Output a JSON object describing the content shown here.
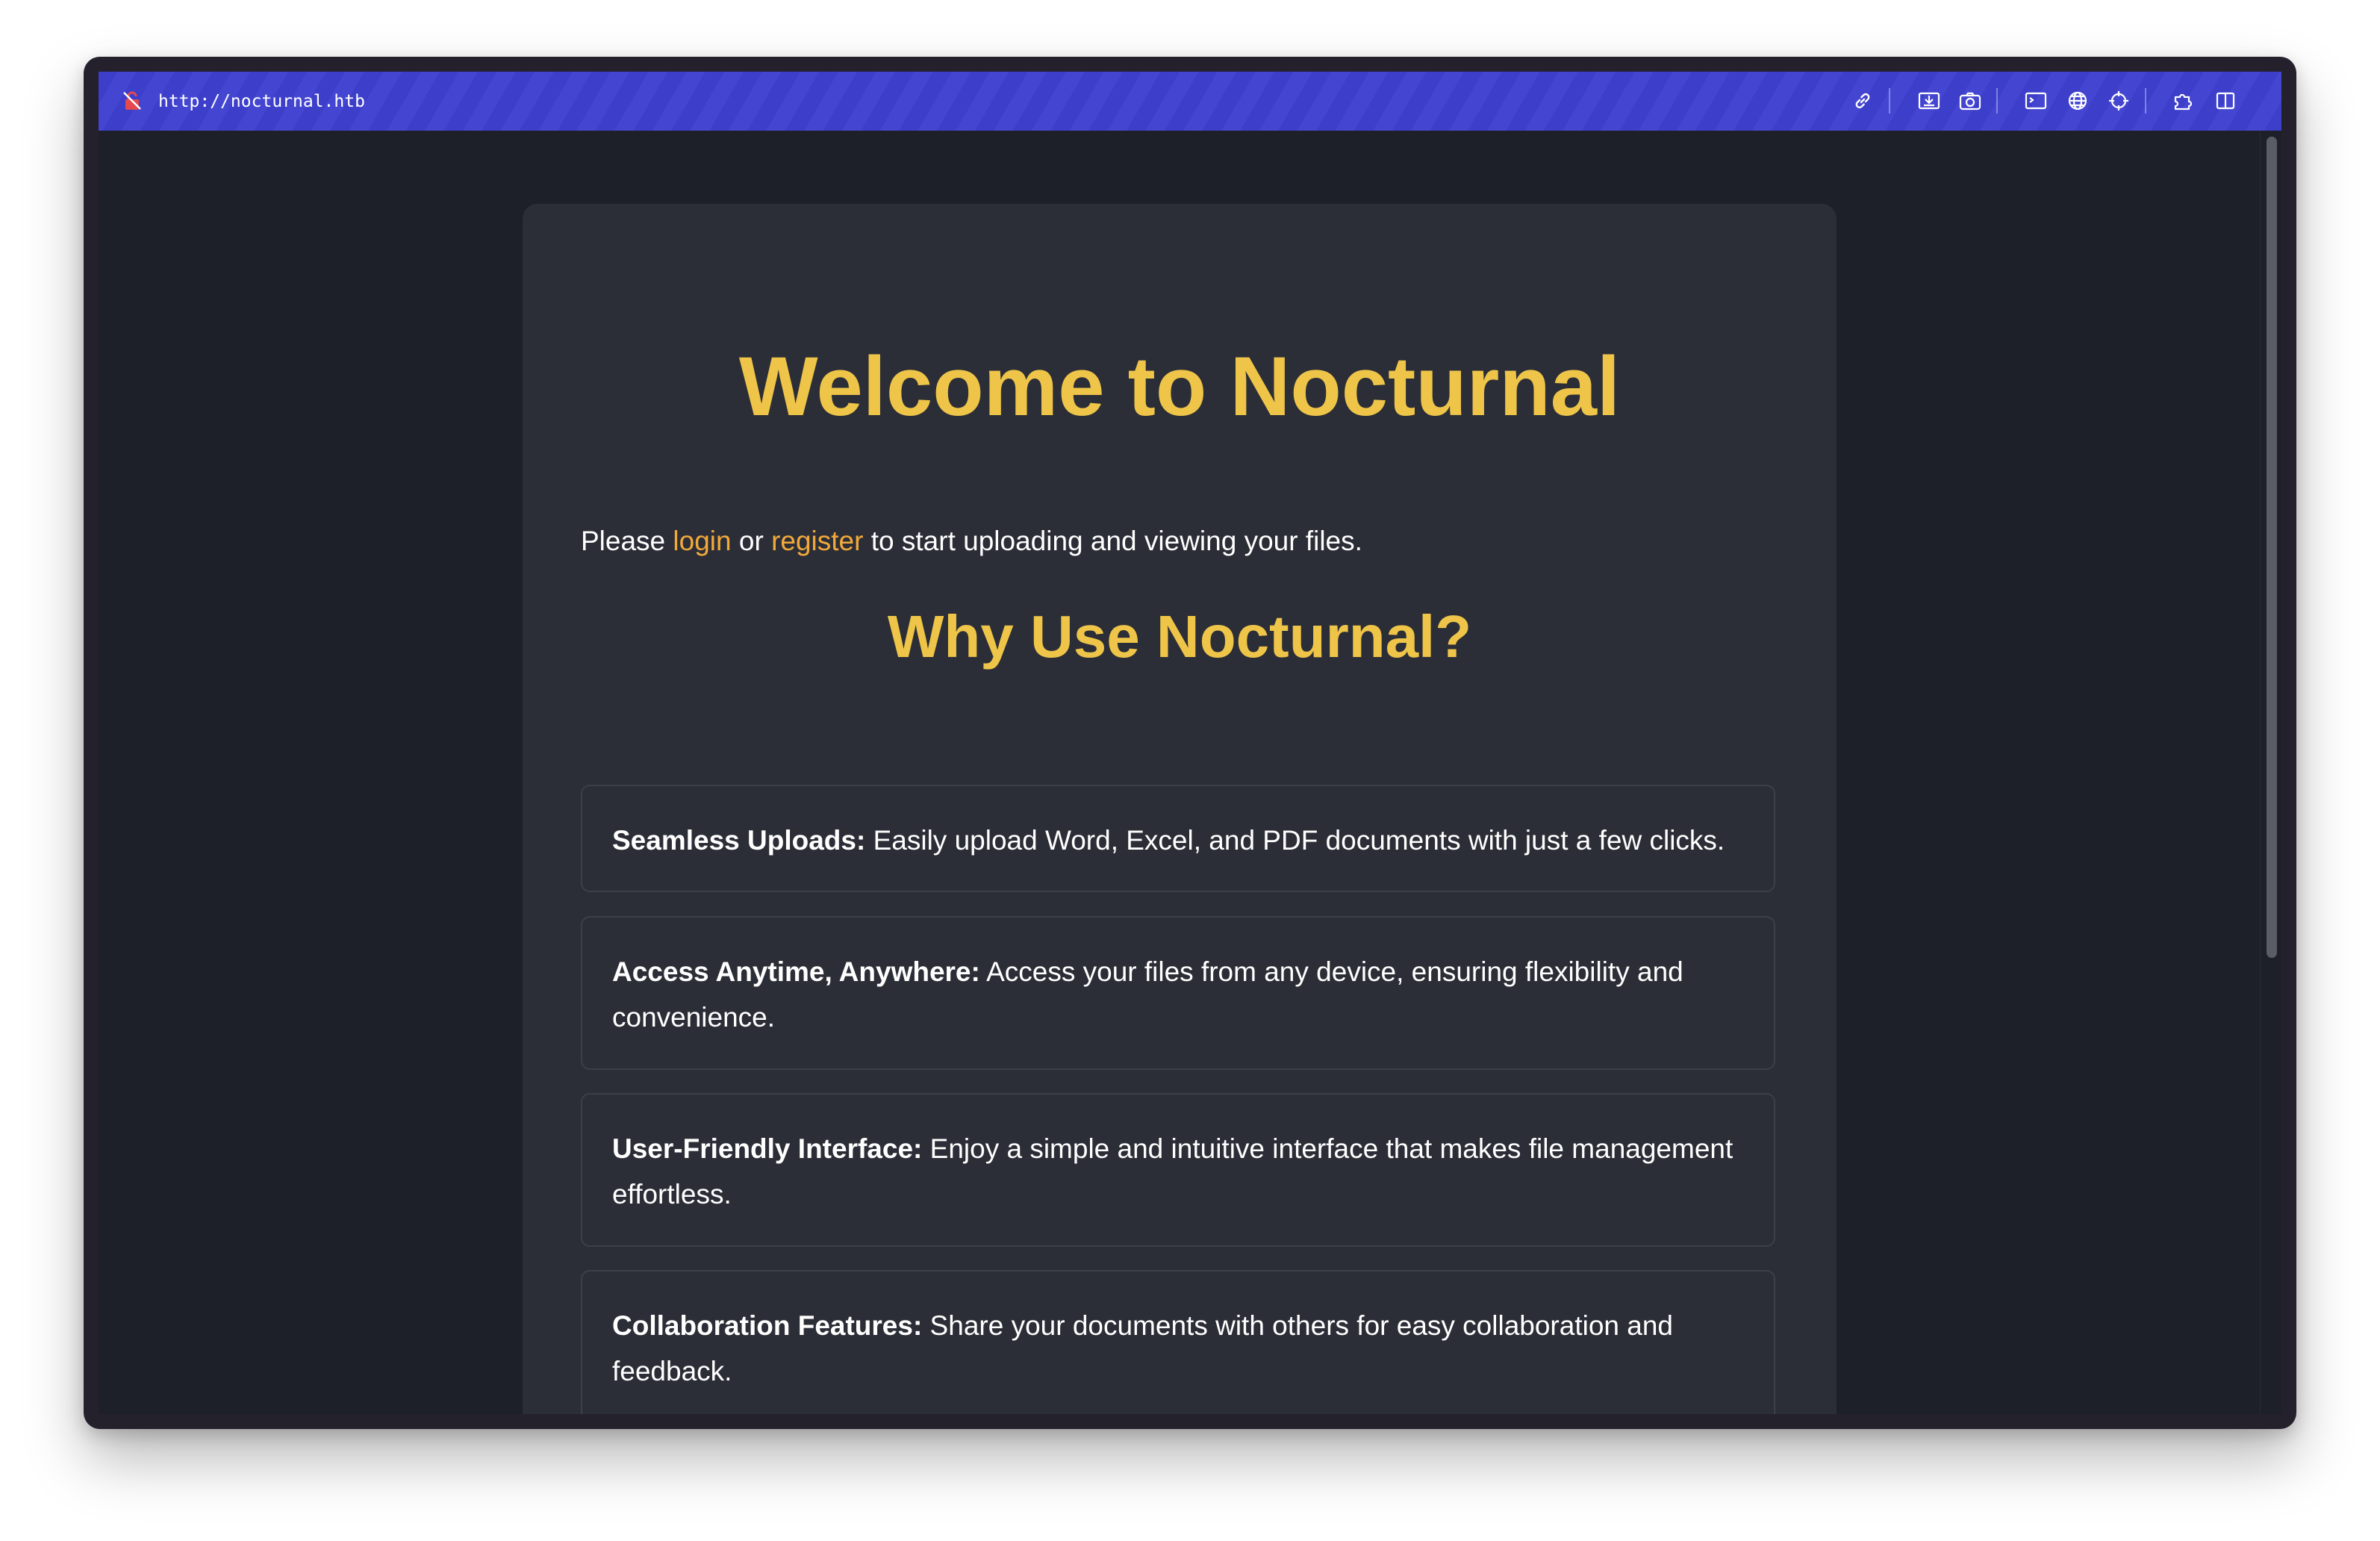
{
  "browser": {
    "url": "http://nocturnal.htb",
    "icons": [
      "lock-icon",
      "link-icon",
      "screenshot-region-icon",
      "camera-icon",
      "terminal-icon",
      "globe-icon",
      "crosshair-icon",
      "extension-icon",
      "sidebar-icon"
    ]
  },
  "page": {
    "title": "Welcome to Nocturnal",
    "intro": {
      "before": "Please ",
      "login": "login",
      "middle": " or ",
      "register": "register",
      "after": " to start uploading and viewing your files."
    },
    "why_heading": "Why Use Nocturnal?",
    "features": [
      {
        "title": "Seamless Uploads:",
        "text": " Easily upload Word, Excel, and PDF documents with just a few clicks."
      },
      {
        "title": "Access Anytime, Anywhere:",
        "text": " Access your files from any device, ensuring flexibility and convenience."
      },
      {
        "title": "User-Friendly Interface:",
        "text": " Enjoy a simple and intuitive interface that makes file management effortless."
      },
      {
        "title": "Collaboration Features:",
        "text": " Share your documents with others for easy collaboration and feedback."
      }
    ]
  },
  "colors": {
    "toolbar": "#3d3fcb",
    "heading": "#eec548",
    "link": "#f2a93b",
    "card": "#2c2e37",
    "background": "#1d2029"
  }
}
